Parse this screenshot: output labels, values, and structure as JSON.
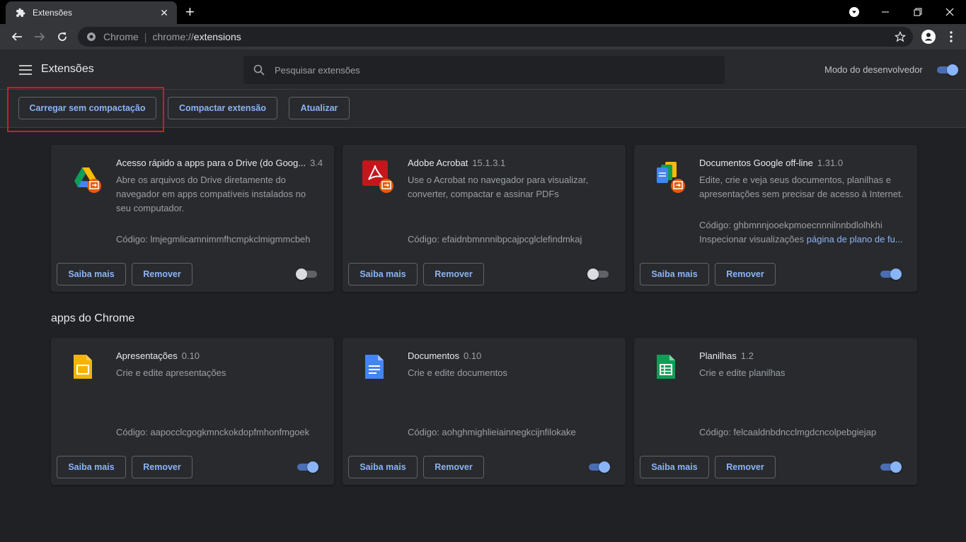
{
  "browser": {
    "tab_title": "Extensões",
    "new_tab_label": "+",
    "address_scheme": "Chrome",
    "address_host": "chrome://",
    "address_path": "extensions"
  },
  "header": {
    "title": "Extensões",
    "search_placeholder": "Pesquisar extensões",
    "dev_mode_label": "Modo do desenvolvedor",
    "dev_mode_on": true
  },
  "actions": {
    "load_unpacked": "Carregar sem compactação",
    "pack_extension": "Compactar extensão",
    "update": "Atualizar"
  },
  "extensions": [
    {
      "name": "Acesso rápido a apps para o Drive (do Goog...",
      "version": "3.4",
      "description": "Abre os arquivos do Drive diretamente do navegador em apps compatíveis instalados no seu computador.",
      "code": "Código: lmjegmlicamnimmfhcmpkclmigmmcbeh",
      "more_label": "Saiba mais",
      "remove_label": "Remover",
      "enabled": false,
      "icon": "google-drive-icon"
    },
    {
      "name": "Adobe Acrobat",
      "version": "15.1.3.1",
      "description": "Use o Acrobat no navegador para visualizar, converter, compactar e assinar PDFs",
      "code": "Código: efaidnbmnnnibpcajpcglclefindmkaj",
      "more_label": "Saiba mais",
      "remove_label": "Remover",
      "enabled": false,
      "icon": "adobe-acrobat-icon"
    },
    {
      "name": "Documentos Google off-line",
      "version": "1.31.0",
      "description": "Edite, crie e veja seus documentos, planilhas e apresentações sem precisar de acesso à Internet.",
      "code": "Código: ghbmnnjooekpmoecnnnilnnbdlolhkhi",
      "inspect_prefix": "Inspecionar visualizações",
      "inspect_link": "página de plano de fu...",
      "more_label": "Saiba mais",
      "remove_label": "Remover",
      "enabled": true,
      "icon": "google-docs-offline-icon"
    }
  ],
  "apps_section_title": "apps do Chrome",
  "apps": [
    {
      "name": "Apresentações",
      "version": "0.10",
      "description": "Crie e edite apresentações",
      "code": "Código: aapocclcgogkmnckokdopfmhonfmgoek",
      "more_label": "Saiba mais",
      "remove_label": "Remover",
      "enabled": true,
      "icon": "google-slides-icon",
      "color": "#f4b400"
    },
    {
      "name": "Documentos",
      "version": "0.10",
      "description": "Crie e edite documentos",
      "code": "Código: aohghmighlieiainnegkcijnfilokake",
      "more_label": "Saiba mais",
      "remove_label": "Remover",
      "enabled": true,
      "icon": "google-docs-icon",
      "color": "#4285f4"
    },
    {
      "name": "Planilhas",
      "version": "1.2",
      "description": "Crie e edite planilhas",
      "code": "Código: felcaaldnbdncclmgdcncolpebgiejap",
      "more_label": "Saiba mais",
      "remove_label": "Remover",
      "enabled": true,
      "icon": "google-sheets-icon",
      "color": "#0f9d58"
    }
  ]
}
